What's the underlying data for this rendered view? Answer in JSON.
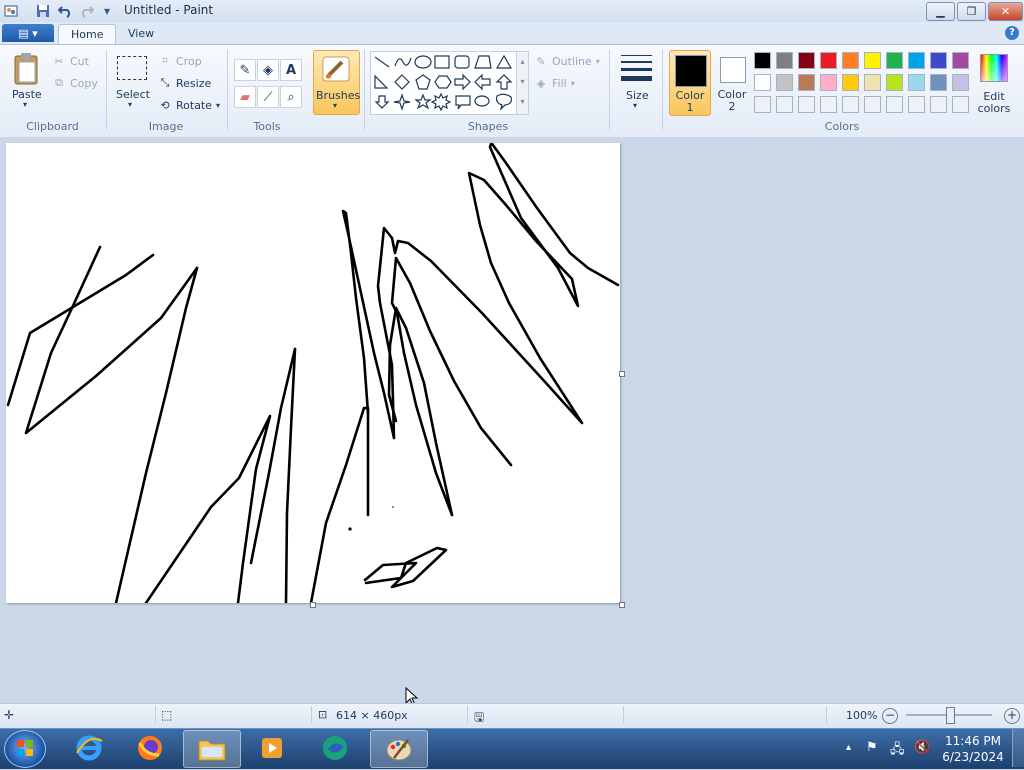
{
  "window": {
    "title": "Untitled - Paint"
  },
  "quick_access": {
    "save_icon": "save-icon",
    "undo_icon": "undo-icon",
    "redo_icon": "redo-icon"
  },
  "tabs": [
    {
      "label": "Home",
      "active": true
    },
    {
      "label": "View",
      "active": false
    }
  ],
  "ribbon": {
    "clipboard": {
      "paste": "Paste",
      "cut": "Cut",
      "copy": "Copy",
      "label": "Clipboard"
    },
    "image": {
      "select": "Select",
      "crop": "Crop",
      "resize": "Resize",
      "rotate": "Rotate",
      "label": "Image"
    },
    "tools": {
      "label": "Tools"
    },
    "brushes": {
      "label": "Brushes"
    },
    "shapes": {
      "outline": "Outline",
      "fill": "Fill",
      "label": "Shapes"
    },
    "size": {
      "label": "Size"
    },
    "colors": {
      "color1_line1": "Color",
      "color1_line2": "1",
      "color2_line1": "Color",
      "color2_line2": "2",
      "edit_line1": "Edit",
      "edit_line2": "colors",
      "label": "Colors",
      "color1": "#000000",
      "color2": "#ffffff",
      "palette_row1": [
        "#000000",
        "#7f7f7f",
        "#880015",
        "#ed1c24",
        "#ff7f27",
        "#fff200",
        "#22b14c",
        "#00a2e8",
        "#3f48cc",
        "#a349a4"
      ],
      "palette_row2": [
        "#ffffff",
        "#c3c3c3",
        "#b97a57",
        "#ffaec9",
        "#ffc90e",
        "#efe4b0",
        "#b5e61d",
        "#99d9ea",
        "#7092be",
        "#c8bfe7"
      ]
    }
  },
  "status": {
    "dimensions": "614 × 460px",
    "zoom": "100%"
  },
  "taskbar": {
    "time": "11:46 PM",
    "date": "6/23/2024"
  }
}
